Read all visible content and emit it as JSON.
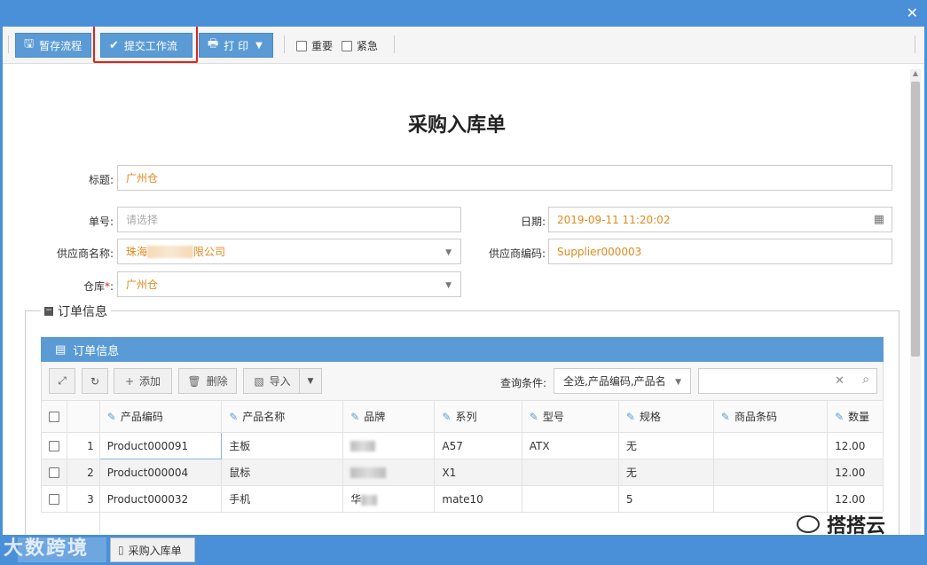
{
  "window": {
    "close_icon": "✕"
  },
  "toolbar": {
    "save_draft_label": "暂存流程",
    "submit_label": "提交工作流",
    "print_label": "打 印",
    "important_label": "重要",
    "urgent_label": "紧急"
  },
  "form": {
    "doc_title": "采购入库单",
    "title_label": "标题:",
    "title_value": "广州仓",
    "order_no_label": "单号:",
    "order_no_placeholder": "请选择",
    "date_label": "日期:",
    "date_value": "2019-09-11 11:20:02",
    "supplier_name_label": "供应商名称:",
    "supplier_name_prefix": "珠海",
    "supplier_name_suffix": "限公司",
    "supplier_code_label": "供应商编码:",
    "supplier_code_value": "Supplier000003",
    "warehouse_label": "仓库",
    "warehouse_required": "*",
    "warehouse_colon": ":",
    "warehouse_value": "广州仓"
  },
  "order_section": {
    "legend": "订单信息",
    "panel_title": "订单信息",
    "add_label": "添加",
    "delete_label": "删除",
    "import_label": "导入",
    "query_label": "查询条件:",
    "query_value": "全选,产品编码,产品名"
  },
  "grid": {
    "columns": [
      "产品编码",
      "产品名称",
      "品牌",
      "系列",
      "型号",
      "规格",
      "商品条码",
      "数量"
    ],
    "rows": [
      {
        "no": "1",
        "code": "Product000091",
        "name": "主板",
        "brand": "",
        "series": "A57",
        "model": "ATX",
        "spec": "无",
        "barcode": "",
        "qty": "12.00"
      },
      {
        "no": "2",
        "code": "Product000004",
        "name": "鼠标",
        "brand": "",
        "series": "X1",
        "model": "",
        "spec": "无",
        "barcode": "",
        "qty": "12.00"
      },
      {
        "no": "3",
        "code": "Product000032",
        "name": "手机",
        "brand": "华",
        "series": "mate10",
        "model": "",
        "spec": "5",
        "barcode": "",
        "qty": "12.00"
      }
    ]
  },
  "taskbar": {
    "tab1_label": "",
    "tab2_label": "采购入库单"
  },
  "watermarks": {
    "left": "大数跨境",
    "right": "搭搭云"
  },
  "colors": {
    "accent": "#5b9bd5",
    "value_text": "#e08a1e",
    "highlight_border": "#d9261c"
  }
}
